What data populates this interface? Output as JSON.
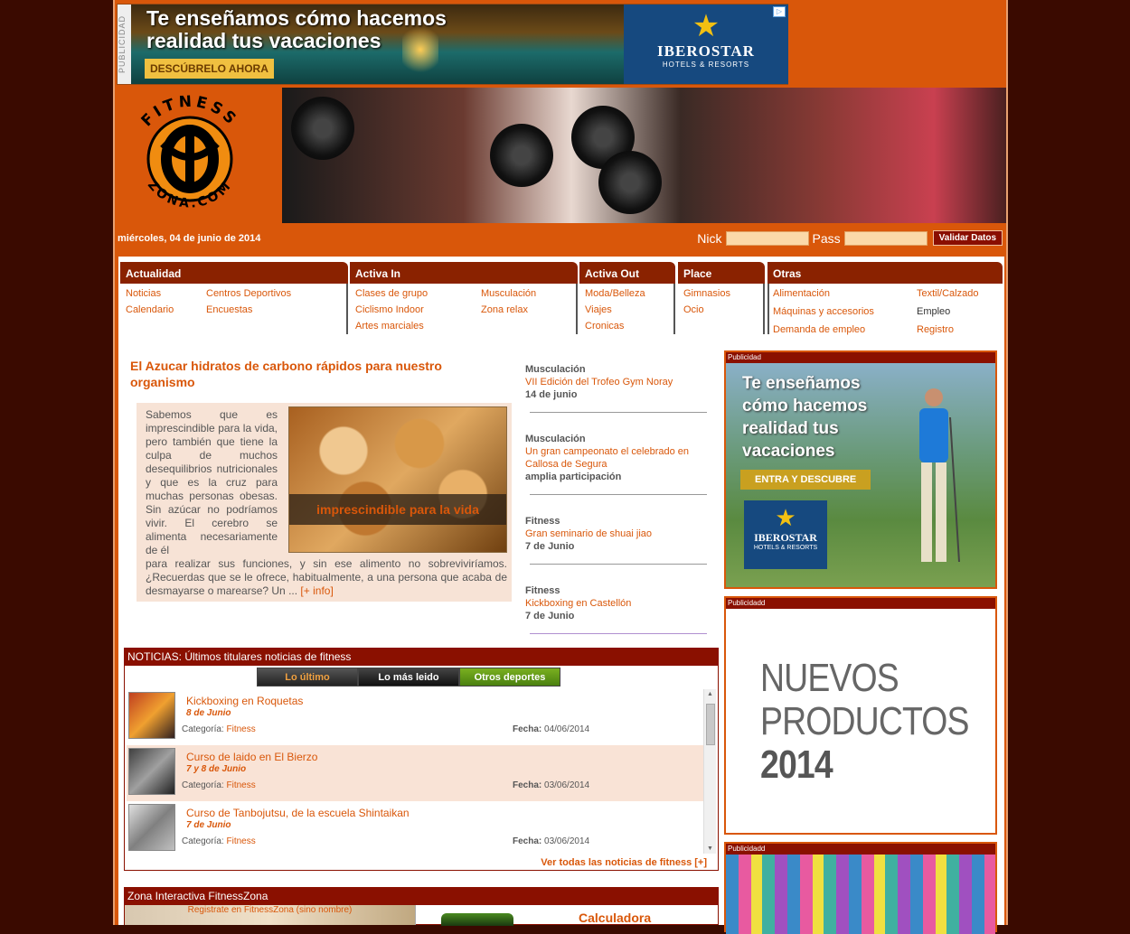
{
  "top_ad": {
    "label": "PUBLICIDAD",
    "headline_line1": "Te enseñamos cómo hacemos",
    "headline_line2": "realidad tus vacaciones",
    "cta": "DESCÚBRELO AHORA",
    "brand": "IBEROSTAR",
    "brand_sub": "HOTELS & RESORTS"
  },
  "logo": {
    "top_text": "FITNESS",
    "bottom_text": "ZONA.COM"
  },
  "date": "miércoles, 04 de junio de 2014",
  "login": {
    "nick_label": "Nick",
    "pass_label": "Pass",
    "submit": "Validar Datos"
  },
  "menu": {
    "actualidad": {
      "title": "Actualidad",
      "items": [
        "Noticias",
        "Calendario",
        "Centros Deportivos",
        "Encuestas"
      ]
    },
    "activa_in": {
      "title": "Activa In",
      "items": [
        "Clases de grupo",
        "Ciclismo Indoor",
        "Artes marciales",
        "Musculación",
        "Zona relax"
      ]
    },
    "activa_out": {
      "title": "Activa Out",
      "items": [
        "Moda/Belleza",
        "Viajes",
        "Cronicas"
      ]
    },
    "place": {
      "title": "Place",
      "items": [
        "Gimnasios",
        "Ocio"
      ]
    },
    "otras": {
      "title": "Otras",
      "items": [
        "Alimentación",
        "Máquinas y accesorios",
        "Demanda de empleo",
        "Textil/Calzado",
        "Empleo",
        "Registro"
      ]
    }
  },
  "article": {
    "title": "El Azucar hidratos de carbono rápidos para nuestro organismo",
    "caption": "imprescindible para la vida",
    "text_a": "Sabemos que es imprescindible para la vida, pero también que tiene la culpa de muchos desequilibrios nutricionales y que es la cruz para muchas personas obesas. Sin azúcar no podríamos vivir. El cerebro se alimenta necesariamente de él",
    "text_b": "para realizar sus funciones, y sin ese alimento no sobreviviríamos. ¿Recuerdas que se le ofrece, habitualmente, a una persona que acaba de desmayarse o marearse? Un ...",
    "more": "[+ info]"
  },
  "side_news": [
    {
      "cat": "Musculación",
      "title": "VII Edición del Trofeo Gym Noray",
      "date": "14 de junio"
    },
    {
      "cat": "Musculación",
      "title": "Un gran campeonato el celebrado en Callosa de Segura",
      "date": "amplia participación"
    },
    {
      "cat": "Fitness",
      "title": "Gran seminario de shuai jiao",
      "date": "7 de Junio"
    },
    {
      "cat": "Fitness",
      "title": "Kickboxing en Castellón",
      "date": "7 de Junio"
    }
  ],
  "news": {
    "header": "NOTICIAS: Últimos titulares noticias de fitness",
    "tabs": [
      "Lo último",
      "Lo más leido",
      "Otros deportes"
    ],
    "cat_label": "Categoría:",
    "date_label": "Fecha:",
    "items": [
      {
        "title": "Kickboxing en Roquetas",
        "when": "8 de Junio",
        "cat": "Fitness",
        "date": "04/06/2014"
      },
      {
        "title": "Curso de laido en El Bierzo",
        "when": "7 y 8 de Junio",
        "cat": "Fitness",
        "date": "03/06/2014"
      },
      {
        "title": "Curso de Tanbojutsu, de la escuela Shintaikan",
        "when": "7 de Junio",
        "cat": "Fitness",
        "date": "03/06/2014"
      }
    ],
    "more": "Ver todas las noticias de fitness [+]"
  },
  "zona": {
    "header": "Zona Interactiva FitnessZona",
    "register": "Registrate en FitnessZona (sino nombre)",
    "calc": "Calculadora"
  },
  "right_ads": {
    "ad1_label": "Publicidad",
    "ad1_lines": [
      "Te enseñamos",
      "cómo hacemos",
      "realidad tus",
      "vacaciones"
    ],
    "ad1_cta": "ENTRA Y DESCUBRE",
    "ad1_brand": "IBEROSTAR",
    "ad1_brand_sub": "HOTELS & RESORTS",
    "ad2_label": "Publicidadd",
    "ad2_line1": "NUEVOS",
    "ad2_line2": "PRODUCTOS",
    "ad2_line3": "2014",
    "ad3_label": "Publicidadd"
  }
}
